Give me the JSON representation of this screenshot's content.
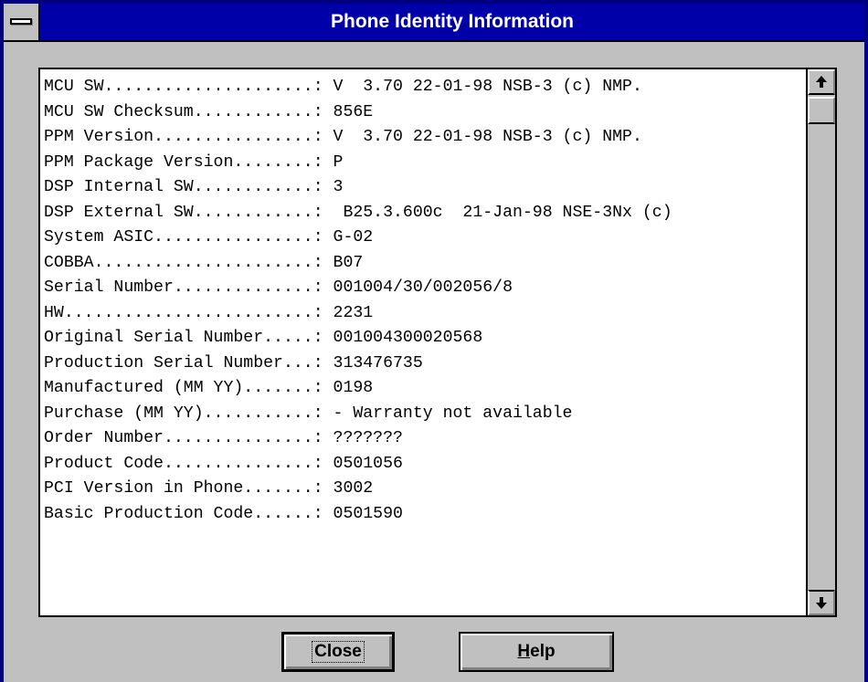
{
  "window": {
    "title": "Phone Identity Information",
    "icon": "system-menu-icon"
  },
  "info_lines": [
    {
      "label": "MCU SW.....................",
      "value": " V  3.70 22-01-98 NSB-3 (c) NMP."
    },
    {
      "label": "MCU SW Checksum............",
      "value": " 856E"
    },
    {
      "label": "PPM Version................",
      "value": " V  3.70 22-01-98 NSB-3 (c) NMP."
    },
    {
      "label": "PPM Package Version........",
      "value": " P"
    },
    {
      "label": "DSP Internal SW............",
      "value": " 3"
    },
    {
      "label": "DSP External SW............",
      "value": "  B25.3.600c  21-Jan-98 NSE-3Nx (c)"
    },
    {
      "label": "System ASIC................",
      "value": " G-02"
    },
    {
      "label": "COBBA......................",
      "value": " B07"
    },
    {
      "label": "Serial Number..............",
      "value": " 001004/30/002056/8"
    },
    {
      "label": "HW.........................",
      "value": " 2231"
    },
    {
      "label": "Original Serial Number.....",
      "value": " 001004300020568"
    },
    {
      "label": "Production Serial Number...",
      "value": " 313476735"
    },
    {
      "label": "Manufactured (MM YY).......",
      "value": " 0198"
    },
    {
      "label": "Purchase (MM YY)...........",
      "value": " - Warranty not available"
    },
    {
      "label": "Order Number...............",
      "value": " ???????"
    },
    {
      "label": "Product Code...............",
      "value": " 0501056"
    },
    {
      "label": "PCI Version in Phone.......",
      "value": " 3002"
    },
    {
      "label": "Basic Production Code......",
      "value": " 0501590"
    }
  ],
  "scrollbar": {
    "up_icon": "scroll-up-arrow-icon",
    "down_icon": "scroll-down-arrow-icon"
  },
  "buttons": {
    "close_label": "Close",
    "help_mnemonic": "H",
    "help_rest": "elp"
  },
  "colors": {
    "titlebar": "#0000a8",
    "face": "#c0c0c0",
    "border": "#000080"
  }
}
